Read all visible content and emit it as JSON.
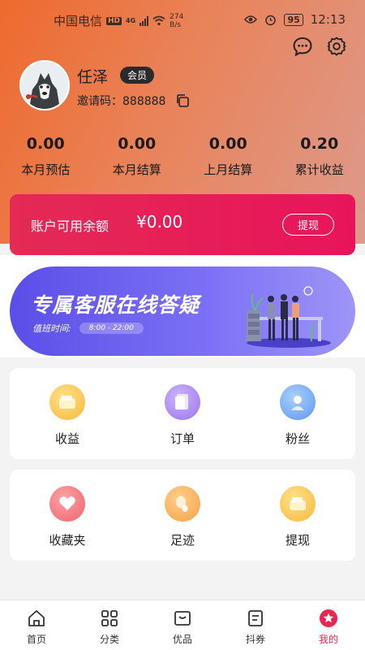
{
  "status": {
    "carrier": "中国电信",
    "hd": "HD",
    "net": "4G",
    "speed_value": "274",
    "speed_unit": "B/s",
    "battery": "95",
    "time": "12:13"
  },
  "profile": {
    "name": "任泽",
    "badge": "会员",
    "invite_label": "邀请码：",
    "invite_code": "888888"
  },
  "stats": [
    {
      "value": "0.00",
      "label": "本月预估"
    },
    {
      "value": "0.00",
      "label": "本月结算"
    },
    {
      "value": "0.00",
      "label": "上月结算"
    },
    {
      "value": "0.20",
      "label": "累计收益"
    }
  ],
  "balance": {
    "label": "账户可用余额",
    "amount": "¥0.00",
    "button": "提现"
  },
  "banner": {
    "title": "专属客服在线答疑",
    "hours_label": "值班时间:",
    "hours": "8:00 - 22:00"
  },
  "menu_row1": [
    {
      "label": "收益",
      "icon": "wallet-icon"
    },
    {
      "label": "订单",
      "icon": "order-icon"
    },
    {
      "label": "粉丝",
      "icon": "fans-icon"
    }
  ],
  "menu_row2": [
    {
      "label": "收藏夹",
      "icon": "heart-icon"
    },
    {
      "label": "足迹",
      "icon": "footprint-icon"
    },
    {
      "label": "提现",
      "icon": "withdraw-icon"
    }
  ],
  "tabs": [
    {
      "label": "首页",
      "icon": "home-icon"
    },
    {
      "label": "分类",
      "icon": "category-icon"
    },
    {
      "label": "优品",
      "icon": "quality-icon"
    },
    {
      "label": "抖券",
      "icon": "coupon-icon"
    },
    {
      "label": "我的",
      "icon": "profile-icon"
    }
  ],
  "colors": {
    "accent": "#e8264f",
    "hero_start": "#ee6a2e",
    "hero_end": "#dd9a8c",
    "banner": "#5b4ee8"
  }
}
